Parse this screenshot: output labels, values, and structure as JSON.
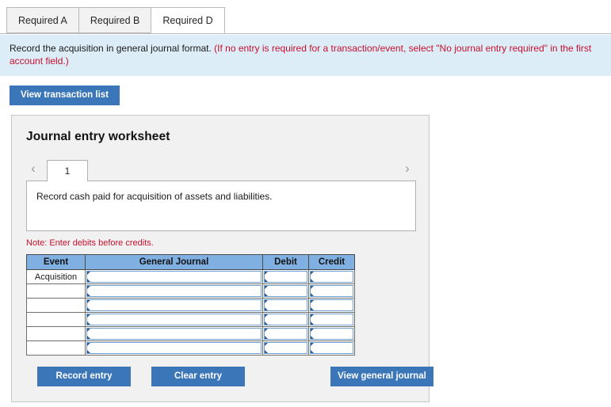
{
  "tabs": [
    {
      "label": "Required A",
      "active": false
    },
    {
      "label": "Required B",
      "active": false
    },
    {
      "label": "Required D",
      "active": true
    }
  ],
  "banner": {
    "main": "Record the acquisition in general journal format.",
    "hint": "(If no entry is required for a transaction/event, select \"No journal entry required\" in the first account field.)"
  },
  "toolbar": {
    "view_transaction_list_label": "View transaction list"
  },
  "worksheet": {
    "title": "Journal entry worksheet",
    "pager": {
      "prev_icon": "chevron-left-icon",
      "next_icon": "chevron-right-icon",
      "current_page": "1"
    },
    "transaction_description": "Record cash paid for acquisition of assets and liabilities.",
    "note": "Note: Enter debits before credits.",
    "table": {
      "headers": [
        "Event",
        "General Journal",
        "Debit",
        "Credit"
      ],
      "rows": [
        {
          "event": "Acquisition",
          "journal": "",
          "debit": "",
          "credit": ""
        },
        {
          "event": "",
          "journal": "",
          "debit": "",
          "credit": ""
        },
        {
          "event": "",
          "journal": "",
          "debit": "",
          "credit": ""
        },
        {
          "event": "",
          "journal": "",
          "debit": "",
          "credit": ""
        },
        {
          "event": "",
          "journal": "",
          "debit": "",
          "credit": ""
        },
        {
          "event": "",
          "journal": "",
          "debit": "",
          "credit": ""
        }
      ]
    },
    "buttons": {
      "record_entry": "Record entry",
      "clear_entry": "Clear entry",
      "view_general_journal": "View general journal"
    }
  },
  "colors": {
    "button_blue": "#3a76b8",
    "banner_blue": "#dcedf7",
    "table_header_blue": "#7fb0e1",
    "panel_gray": "#f1f1f1",
    "alert_red": "#c8102e",
    "field_border_blue": "#6f9fd0"
  }
}
